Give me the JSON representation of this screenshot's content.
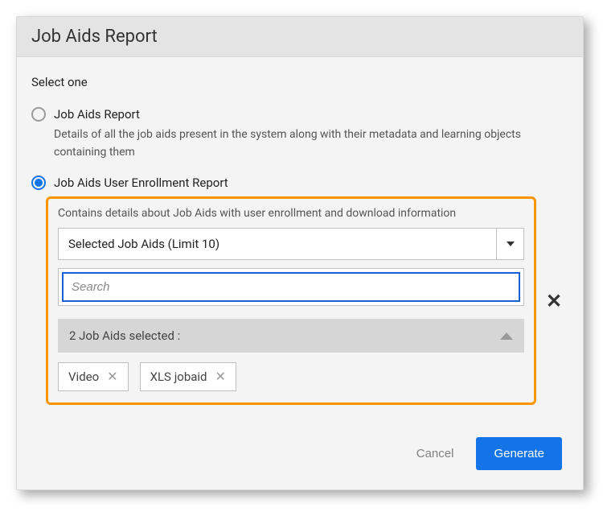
{
  "dialog": {
    "title": "Job Aids Report",
    "instruction": "Select one"
  },
  "options": {
    "jobAids": {
      "label": "Job Aids Report",
      "description": "Details of all the job aids present in the system along with their metadata and learning objects containing them"
    },
    "enrollment": {
      "label": "Job Aids User Enrollment Report",
      "description": "Contains details about Job Aids with user enrollment and download information"
    }
  },
  "selector": {
    "dropdownLabel": "Selected Job Aids (Limit 10)",
    "searchPlaceholder": "Search",
    "selectedSummary": "2 Job Aids selected :",
    "chips": [
      "Video",
      "XLS jobaid"
    ]
  },
  "buttons": {
    "cancel": "Cancel",
    "generate": "Generate"
  }
}
